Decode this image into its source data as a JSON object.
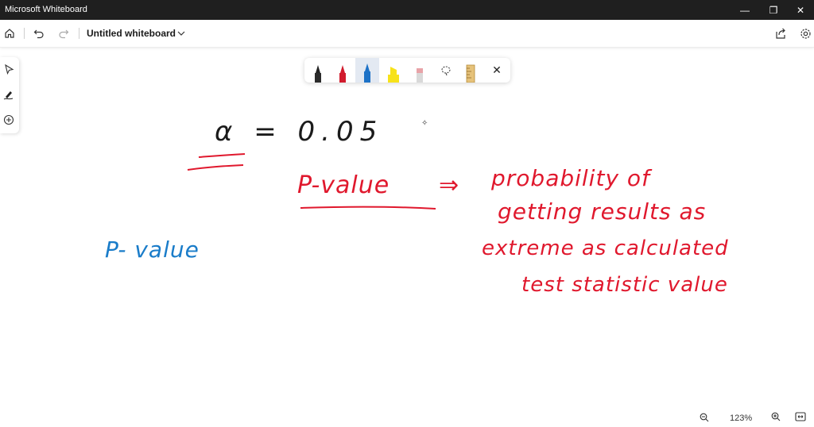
{
  "window": {
    "app_title": "Microsoft Whiteboard",
    "minimize": "—",
    "maximize": "❐",
    "close": "✕"
  },
  "appbar": {
    "board_title": "Untitled whiteboard",
    "icons": [
      "home-icon",
      "undo-icon",
      "redo-icon",
      "chevron-down-icon",
      "share-icon",
      "settings-icon"
    ]
  },
  "left_toolbar": {
    "tools": [
      "select-icon",
      "inking-icon",
      "add-icon"
    ]
  },
  "pen_tray": {
    "tools": [
      {
        "name": "black-pen",
        "color": "#222222"
      },
      {
        "name": "red-pen",
        "color": "#d11b2d"
      },
      {
        "name": "blue-pen",
        "color": "#1d72c7"
      },
      {
        "name": "yellow-highlighter",
        "color": "#f7e21a"
      },
      {
        "name": "eraser",
        "color": "#e8a3a8"
      },
      {
        "name": "lasso",
        "color": "#444444"
      },
      {
        "name": "ruler",
        "color": "#e6c27a"
      }
    ],
    "close": "✕"
  },
  "ink": {
    "alpha": "α = 0.05",
    "pvalue_red": "P-value",
    "arrow": "⇒",
    "line1": "probability of",
    "line2": "getting results as",
    "line3": "extreme as calculated",
    "line4": "test statistic value",
    "pvalue_blue": "P- value",
    "colors": {
      "black": "#1b1b1b",
      "red": "#e0182d",
      "blue": "#1a7cc9"
    }
  },
  "zoom": {
    "level": "123%",
    "zoom_out": "−",
    "zoom_in": "+"
  }
}
